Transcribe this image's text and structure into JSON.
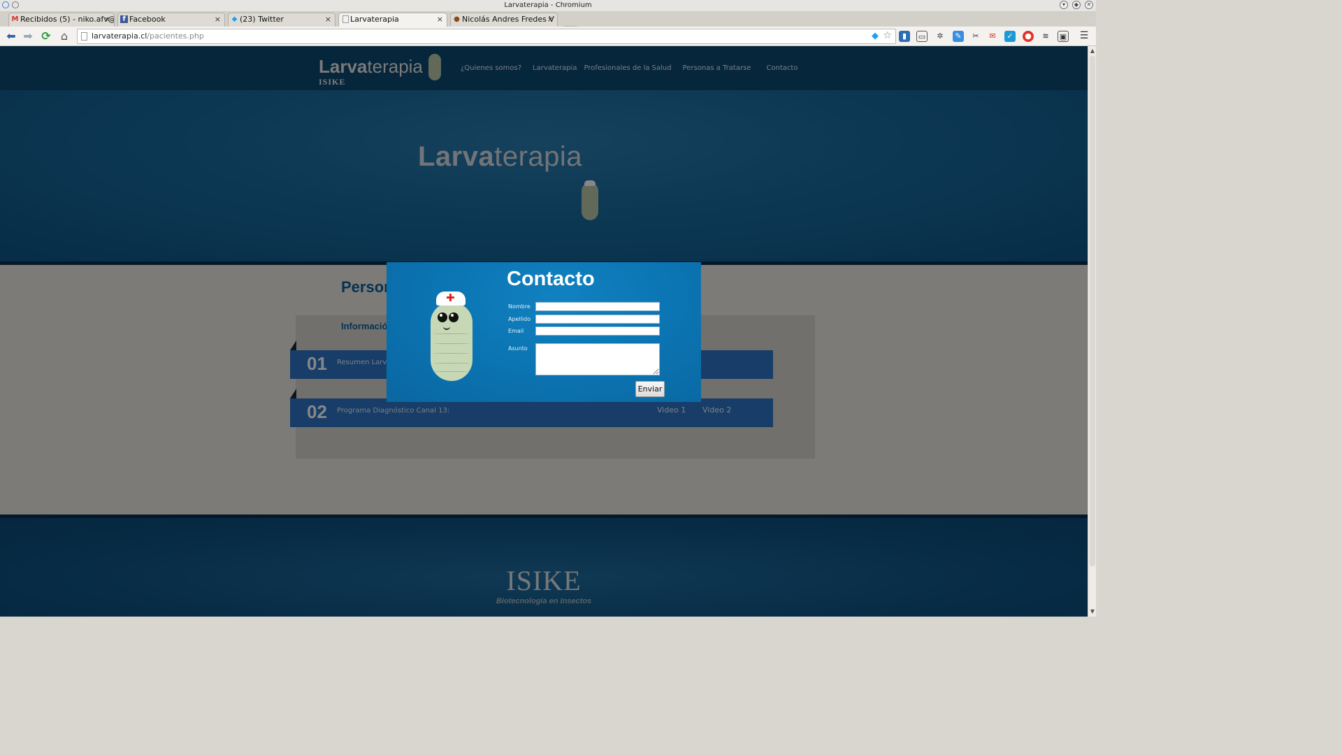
{
  "window": {
    "title": "Larvaterapia - Chromium"
  },
  "tabs": [
    {
      "label": "Recibidos (5) - niko.afv@",
      "icon": "gmail-icon",
      "active": false
    },
    {
      "label": "Facebook",
      "icon": "facebook-icon",
      "active": false
    },
    {
      "label": "(23) Twitter",
      "icon": "twitter-icon",
      "active": false
    },
    {
      "label": "Larvaterapia",
      "icon": "page-icon",
      "active": true
    },
    {
      "label": "Nicolás Andres Fredes V",
      "icon": "profile-icon",
      "active": false
    }
  ],
  "toolbar": {
    "url_host": "larvaterapia.cl",
    "url_path": "/pacientes.php"
  },
  "site": {
    "logo_bold": "Larva",
    "logo_light": "terapia",
    "logo_sub": "ISIKE",
    "nav": [
      "¿Quienes somos?",
      "Larvaterapia",
      "Profesionales de la Salud",
      "Personas a Tratarse",
      "Contacto"
    ],
    "hero_bold": "Larva",
    "hero_light": "terapia",
    "section_title": "Person",
    "panel_subtitle": "Informació",
    "rows": [
      {
        "num": "01",
        "text": "Resumen Larv"
      },
      {
        "num": "02",
        "text": "Programa Diagnóstico Canal 13:",
        "video1": "Video 1",
        "video2": "Video 2"
      }
    ],
    "footer_brand": "ISIKE",
    "footer_tagline": "Biotecnologia en Insectos"
  },
  "modal": {
    "title": "Contacto",
    "fields": {
      "nombre_label": "Nombre",
      "apellido_label": "Apellido",
      "email_label": "Email",
      "asunto_label": "Asunto"
    },
    "submit_label": "Enviar"
  },
  "colors": {
    "nav_bg": "#0d4870",
    "hero_blue": "#186a9e",
    "modal_blue": "#0b74b2",
    "ribbon_blue": "#2c73c4",
    "title_blue": "#0e5f97"
  }
}
